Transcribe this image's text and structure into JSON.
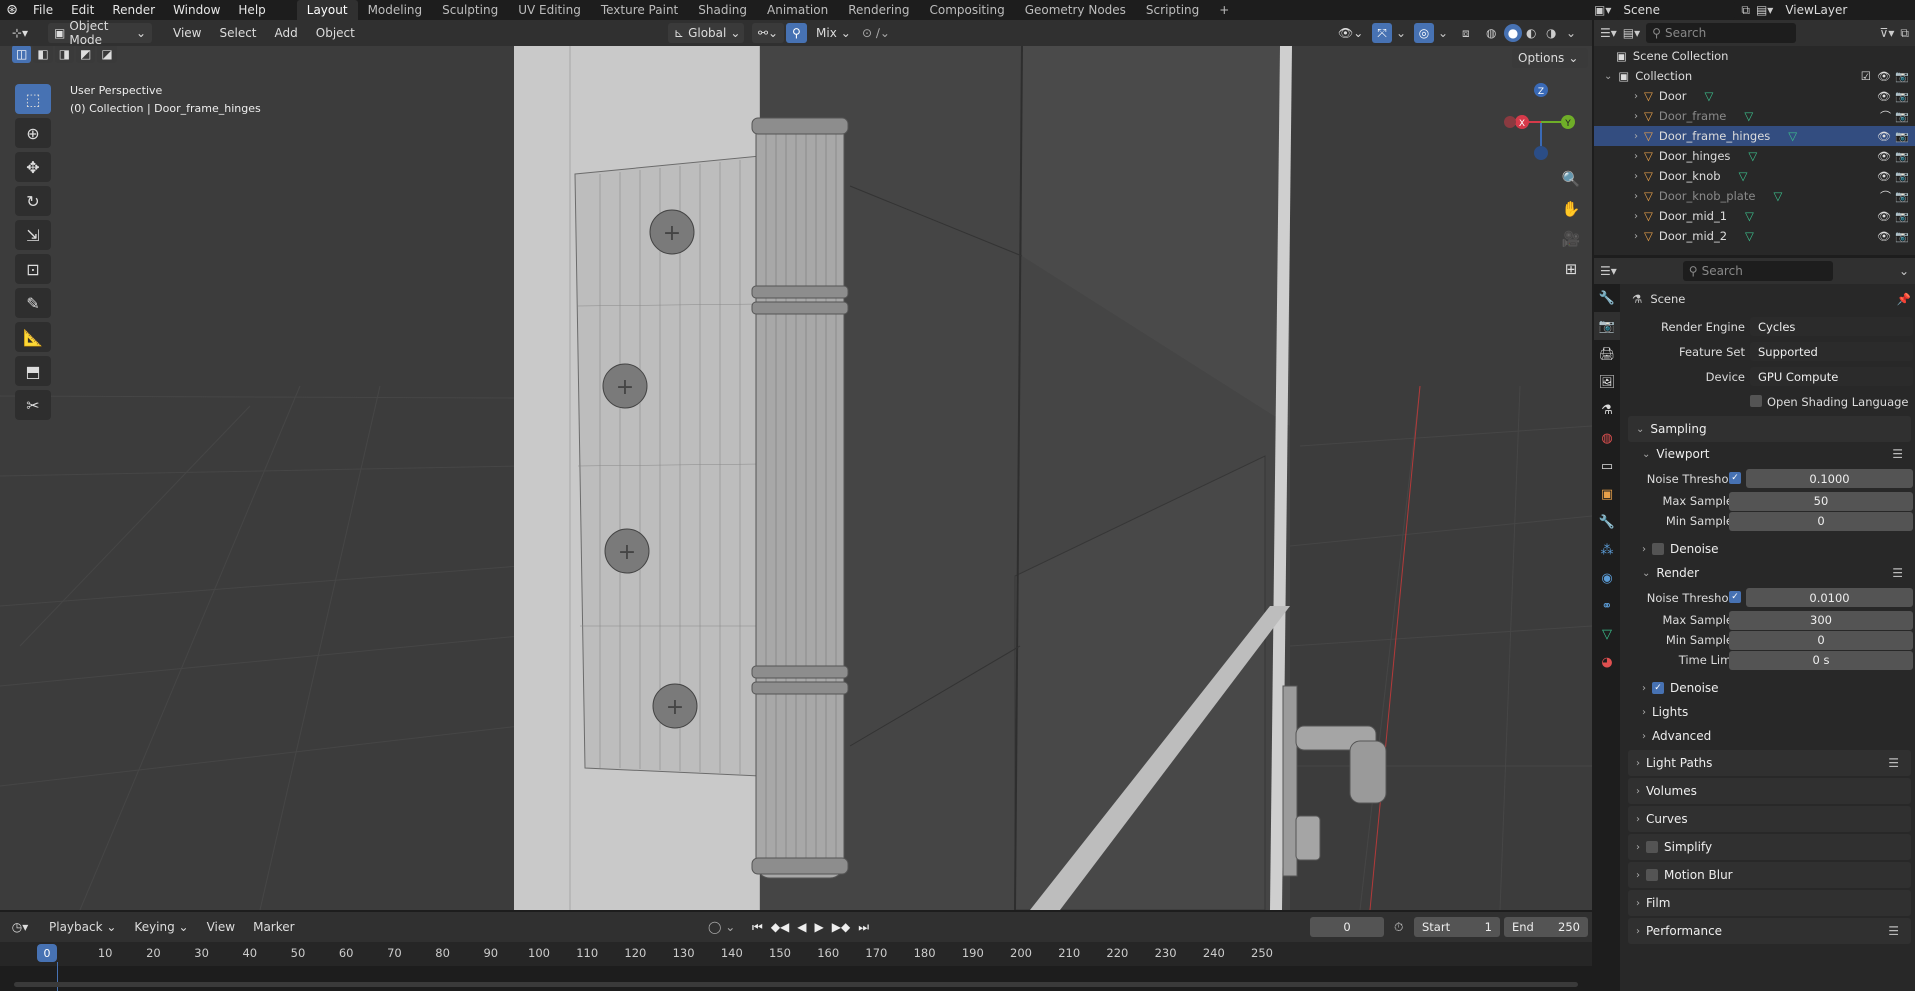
{
  "topbar": {
    "menus": [
      "File",
      "Edit",
      "Render",
      "Window",
      "Help"
    ],
    "workspaces": [
      "Layout",
      "Modeling",
      "Sculpting",
      "UV Editing",
      "Texture Paint",
      "Shading",
      "Animation",
      "Rendering",
      "Compositing",
      "Geometry Nodes",
      "Scripting"
    ],
    "active_workspace": "Layout",
    "scene": "Scene",
    "view_layer": "ViewLayer"
  },
  "viewport_header": {
    "mode": "Object Mode",
    "menus": [
      "View",
      "Select",
      "Add",
      "Object"
    ],
    "orientation": "Global",
    "snap_mix": "Mix",
    "options": "Options"
  },
  "viewport": {
    "perspective": "User Perspective",
    "context": "(0) Collection | Door_frame_hinges"
  },
  "gizmo": {
    "x": "X",
    "y": "Y",
    "z": "Z"
  },
  "outliner": {
    "search_placeholder": "Search",
    "scene_collection": "Scene Collection",
    "collection": "Collection",
    "items": [
      {
        "name": "Door",
        "state": "normal"
      },
      {
        "name": "Door_frame",
        "state": "dim"
      },
      {
        "name": "Door_frame_hinges",
        "state": "selected"
      },
      {
        "name": "Door_hinges",
        "state": "normal"
      },
      {
        "name": "Door_knob",
        "state": "normal"
      },
      {
        "name": "Door_knob_plate",
        "state": "dim"
      },
      {
        "name": "Door_mid_1",
        "state": "normal"
      },
      {
        "name": "Door_mid_2",
        "state": "normal"
      }
    ]
  },
  "properties": {
    "search_placeholder": "Search",
    "context": "Scene",
    "render_engine_label": "Render Engine",
    "render_engine": "Cycles",
    "feature_set_label": "Feature Set",
    "feature_set": "Supported",
    "device_label": "Device",
    "device": "GPU Compute",
    "osl_label": "Open Shading Language",
    "sampling": "Sampling",
    "viewport_panel": "Viewport",
    "vp_noise_label": "Noise Threshold",
    "vp_noise": "0.1000",
    "vp_max_label": "Max Samples",
    "vp_max": "50",
    "vp_min_label": "Min Samples",
    "vp_min": "0",
    "vp_denoise": "Denoise",
    "render_panel": "Render",
    "r_noise_label": "Noise Threshold",
    "r_noise": "0.0100",
    "r_max_label": "Max Samples",
    "r_max": "300",
    "r_min_label": "Min Samples",
    "r_min": "0",
    "r_time_label": "Time Limit",
    "r_time": "0 s",
    "r_denoise": "Denoise",
    "lights": "Lights",
    "advanced": "Advanced",
    "light_paths": "Light Paths",
    "volumes": "Volumes",
    "curves": "Curves",
    "simplify": "Simplify",
    "motion_blur": "Motion Blur",
    "film": "Film",
    "performance": "Performance"
  },
  "timeline": {
    "menus": [
      "Playback",
      "Keying",
      "View",
      "Marker"
    ],
    "current_frame": "0",
    "start_label": "Start",
    "start": "1",
    "end_label": "End",
    "end": "250",
    "ticks": [
      "0",
      "10",
      "20",
      "30",
      "40",
      "50",
      "60",
      "70",
      "80",
      "90",
      "100",
      "110",
      "120",
      "130",
      "140",
      "150",
      "160",
      "170",
      "180",
      "190",
      "200",
      "210",
      "220",
      "230",
      "240",
      "250"
    ]
  },
  "colors": {
    "accent": "#4772b3",
    "selected_row": "#334d80",
    "object_icon": "#e8a04a",
    "mesh_icon": "#3cbf8c"
  }
}
